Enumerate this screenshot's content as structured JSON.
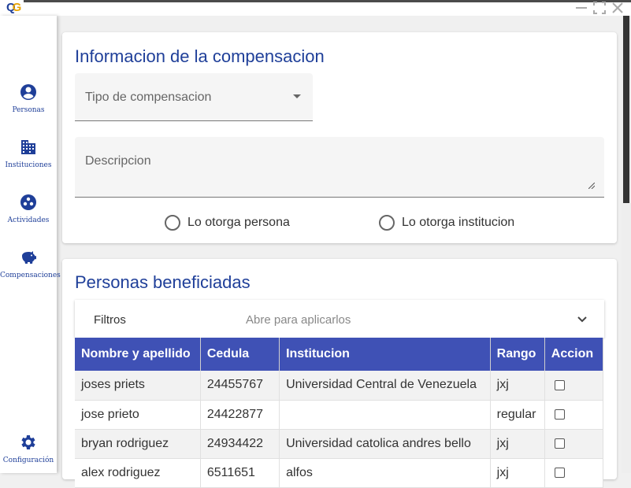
{
  "window": {
    "logo": {
      "q": "Q",
      "g": "G"
    }
  },
  "sidebar": {
    "items": [
      {
        "label": "Personas",
        "icon": "account-circle-icon"
      },
      {
        "label": "Instituciones",
        "icon": "business-icon"
      },
      {
        "label": "Actividades",
        "icon": "group-work-icon"
      },
      {
        "label": "Compensaciones",
        "icon": "savings-icon"
      }
    ],
    "config": {
      "label": "Configuración",
      "icon": "gear-icon"
    }
  },
  "info": {
    "title": "Informacion de la compensacion",
    "tipo_placeholder": "Tipo de compensacion",
    "descripcion_placeholder": "Descripcion",
    "radio_persona": "Lo otorga persona",
    "radio_institucion": "Lo otorga institucion"
  },
  "beneficiadas": {
    "title": "Personas beneficiadas",
    "filter_label": "Filtros",
    "filter_hint": "Abre para aplicarlos",
    "columns": [
      "Nombre y apellido",
      "Cedula",
      "Institucion",
      "Rango",
      "Accion"
    ],
    "rows": [
      {
        "nombre": "joses priets",
        "cedula": "24455767",
        "institucion": "Universidad Central de Venezuela",
        "rango": "jxj"
      },
      {
        "nombre": "jose prieto",
        "cedula": "24422877",
        "institucion": "",
        "rango": "regular"
      },
      {
        "nombre": "bryan rodriguez",
        "cedula": "24934422",
        "institucion": "Universidad catolica andres bello",
        "rango": "jxj"
      },
      {
        "nombre": "alex rodriguez",
        "cedula": "6511651",
        "institucion": "alfos",
        "rango": "jxj"
      }
    ]
  },
  "colors": {
    "accent": "#1f3f99",
    "header": "#3f51b5"
  }
}
